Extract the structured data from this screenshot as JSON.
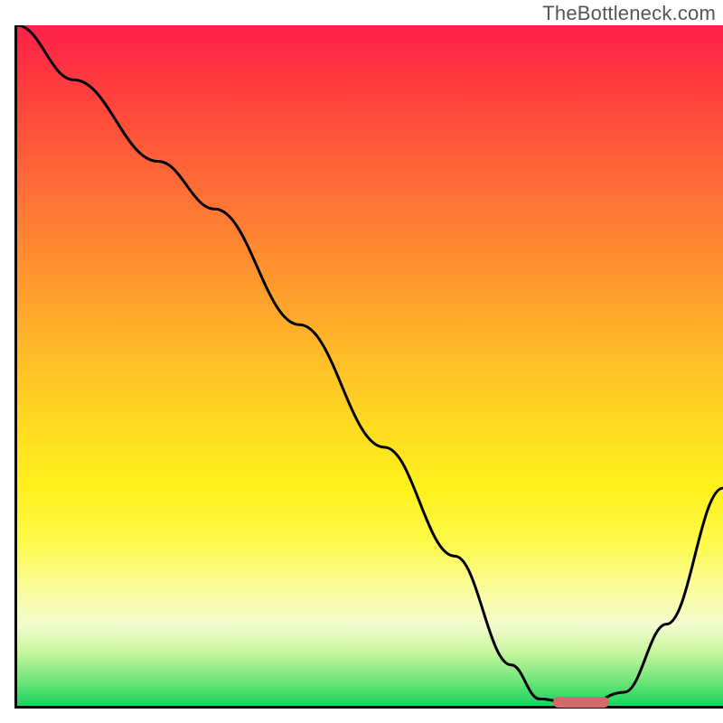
{
  "watermark": "TheBottleneck.com",
  "chart_data": {
    "type": "line",
    "title": "",
    "xlabel": "",
    "ylabel": "",
    "xlim": [
      0,
      100
    ],
    "ylim": [
      0,
      100
    ],
    "x": [
      0,
      8,
      20,
      28,
      40,
      52,
      62,
      70,
      74,
      80,
      86,
      92,
      100
    ],
    "values": [
      100,
      92,
      80,
      73,
      56,
      38,
      22,
      6,
      1,
      0,
      2,
      12,
      32
    ],
    "annotations": [
      {
        "type": "marker",
        "x_start": 76,
        "x_end": 84,
        "y": 0.5,
        "color": "#d46a6a"
      }
    ],
    "background": "vertical-gradient-red-to-green"
  },
  "colors": {
    "axis": "#000000",
    "curve": "#000000",
    "marker": "#d46a6a",
    "watermark_text": "#555555"
  }
}
